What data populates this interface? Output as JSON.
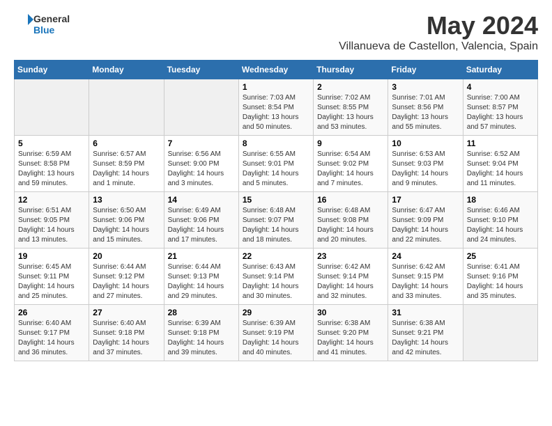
{
  "logo": {
    "general": "General",
    "blue": "Blue"
  },
  "title": "May 2024",
  "subtitle": "Villanueva de Castellon, Valencia, Spain",
  "days_header": [
    "Sunday",
    "Monday",
    "Tuesday",
    "Wednesday",
    "Thursday",
    "Friday",
    "Saturday"
  ],
  "weeks": [
    [
      {
        "day": "",
        "empty": true
      },
      {
        "day": "",
        "empty": true
      },
      {
        "day": "",
        "empty": true
      },
      {
        "day": "1",
        "sunrise": "Sunrise: 7:03 AM",
        "sunset": "Sunset: 8:54 PM",
        "daylight": "Daylight: 13 hours and 50 minutes."
      },
      {
        "day": "2",
        "sunrise": "Sunrise: 7:02 AM",
        "sunset": "Sunset: 8:55 PM",
        "daylight": "Daylight: 13 hours and 53 minutes."
      },
      {
        "day": "3",
        "sunrise": "Sunrise: 7:01 AM",
        "sunset": "Sunset: 8:56 PM",
        "daylight": "Daylight: 13 hours and 55 minutes."
      },
      {
        "day": "4",
        "sunrise": "Sunrise: 7:00 AM",
        "sunset": "Sunset: 8:57 PM",
        "daylight": "Daylight: 13 hours and 57 minutes."
      }
    ],
    [
      {
        "day": "5",
        "sunrise": "Sunrise: 6:59 AM",
        "sunset": "Sunset: 8:58 PM",
        "daylight": "Daylight: 13 hours and 59 minutes."
      },
      {
        "day": "6",
        "sunrise": "Sunrise: 6:57 AM",
        "sunset": "Sunset: 8:59 PM",
        "daylight": "Daylight: 14 hours and 1 minute."
      },
      {
        "day": "7",
        "sunrise": "Sunrise: 6:56 AM",
        "sunset": "Sunset: 9:00 PM",
        "daylight": "Daylight: 14 hours and 3 minutes."
      },
      {
        "day": "8",
        "sunrise": "Sunrise: 6:55 AM",
        "sunset": "Sunset: 9:01 PM",
        "daylight": "Daylight: 14 hours and 5 minutes."
      },
      {
        "day": "9",
        "sunrise": "Sunrise: 6:54 AM",
        "sunset": "Sunset: 9:02 PM",
        "daylight": "Daylight: 14 hours and 7 minutes."
      },
      {
        "day": "10",
        "sunrise": "Sunrise: 6:53 AM",
        "sunset": "Sunset: 9:03 PM",
        "daylight": "Daylight: 14 hours and 9 minutes."
      },
      {
        "day": "11",
        "sunrise": "Sunrise: 6:52 AM",
        "sunset": "Sunset: 9:04 PM",
        "daylight": "Daylight: 14 hours and 11 minutes."
      }
    ],
    [
      {
        "day": "12",
        "sunrise": "Sunrise: 6:51 AM",
        "sunset": "Sunset: 9:05 PM",
        "daylight": "Daylight: 14 hours and 13 minutes."
      },
      {
        "day": "13",
        "sunrise": "Sunrise: 6:50 AM",
        "sunset": "Sunset: 9:06 PM",
        "daylight": "Daylight: 14 hours and 15 minutes."
      },
      {
        "day": "14",
        "sunrise": "Sunrise: 6:49 AM",
        "sunset": "Sunset: 9:06 PM",
        "daylight": "Daylight: 14 hours and 17 minutes."
      },
      {
        "day": "15",
        "sunrise": "Sunrise: 6:48 AM",
        "sunset": "Sunset: 9:07 PM",
        "daylight": "Daylight: 14 hours and 18 minutes."
      },
      {
        "day": "16",
        "sunrise": "Sunrise: 6:48 AM",
        "sunset": "Sunset: 9:08 PM",
        "daylight": "Daylight: 14 hours and 20 minutes."
      },
      {
        "day": "17",
        "sunrise": "Sunrise: 6:47 AM",
        "sunset": "Sunset: 9:09 PM",
        "daylight": "Daylight: 14 hours and 22 minutes."
      },
      {
        "day": "18",
        "sunrise": "Sunrise: 6:46 AM",
        "sunset": "Sunset: 9:10 PM",
        "daylight": "Daylight: 14 hours and 24 minutes."
      }
    ],
    [
      {
        "day": "19",
        "sunrise": "Sunrise: 6:45 AM",
        "sunset": "Sunset: 9:11 PM",
        "daylight": "Daylight: 14 hours and 25 minutes."
      },
      {
        "day": "20",
        "sunrise": "Sunrise: 6:44 AM",
        "sunset": "Sunset: 9:12 PM",
        "daylight": "Daylight: 14 hours and 27 minutes."
      },
      {
        "day": "21",
        "sunrise": "Sunrise: 6:44 AM",
        "sunset": "Sunset: 9:13 PM",
        "daylight": "Daylight: 14 hours and 29 minutes."
      },
      {
        "day": "22",
        "sunrise": "Sunrise: 6:43 AM",
        "sunset": "Sunset: 9:14 PM",
        "daylight": "Daylight: 14 hours and 30 minutes."
      },
      {
        "day": "23",
        "sunrise": "Sunrise: 6:42 AM",
        "sunset": "Sunset: 9:14 PM",
        "daylight": "Daylight: 14 hours and 32 minutes."
      },
      {
        "day": "24",
        "sunrise": "Sunrise: 6:42 AM",
        "sunset": "Sunset: 9:15 PM",
        "daylight": "Daylight: 14 hours and 33 minutes."
      },
      {
        "day": "25",
        "sunrise": "Sunrise: 6:41 AM",
        "sunset": "Sunset: 9:16 PM",
        "daylight": "Daylight: 14 hours and 35 minutes."
      }
    ],
    [
      {
        "day": "26",
        "sunrise": "Sunrise: 6:40 AM",
        "sunset": "Sunset: 9:17 PM",
        "daylight": "Daylight: 14 hours and 36 minutes."
      },
      {
        "day": "27",
        "sunrise": "Sunrise: 6:40 AM",
        "sunset": "Sunset: 9:18 PM",
        "daylight": "Daylight: 14 hours and 37 minutes."
      },
      {
        "day": "28",
        "sunrise": "Sunrise: 6:39 AM",
        "sunset": "Sunset: 9:18 PM",
        "daylight": "Daylight: 14 hours and 39 minutes."
      },
      {
        "day": "29",
        "sunrise": "Sunrise: 6:39 AM",
        "sunset": "Sunset: 9:19 PM",
        "daylight": "Daylight: 14 hours and 40 minutes."
      },
      {
        "day": "30",
        "sunrise": "Sunrise: 6:38 AM",
        "sunset": "Sunset: 9:20 PM",
        "daylight": "Daylight: 14 hours and 41 minutes."
      },
      {
        "day": "31",
        "sunrise": "Sunrise: 6:38 AM",
        "sunset": "Sunset: 9:21 PM",
        "daylight": "Daylight: 14 hours and 42 minutes."
      },
      {
        "day": "",
        "empty": true
      }
    ]
  ]
}
